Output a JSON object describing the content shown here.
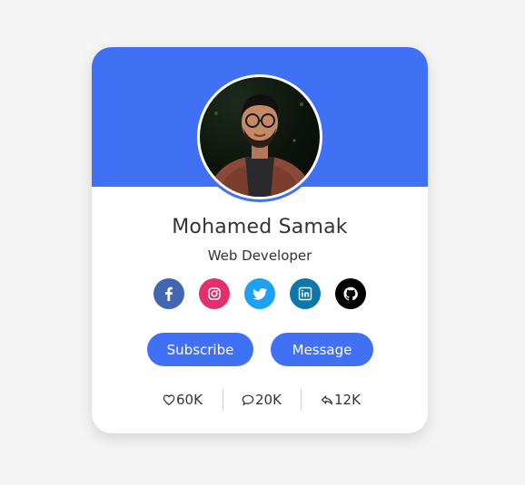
{
  "profile": {
    "name": "Mohamed Samak",
    "job": "Web Developer"
  },
  "socials": [
    {
      "name": "facebook",
      "icon": "facebook-icon",
      "color": "#4267b2"
    },
    {
      "name": "instagram",
      "icon": "instagram-icon",
      "color": "#e1306c"
    },
    {
      "name": "twitter",
      "icon": "twitter-icon",
      "color": "#1da1f2"
    },
    {
      "name": "linkedin",
      "icon": "linkedin-icon",
      "color": "#0e76a8"
    },
    {
      "name": "github",
      "icon": "github-icon",
      "color": "#000000"
    }
  ],
  "buttons": {
    "subscribe_label": "Subscribe",
    "message_label": "Message"
  },
  "stats": {
    "likes": "60K",
    "comments": "20K",
    "shares": "12K"
  },
  "colors": {
    "accent": "#4070f4",
    "text": "#333333",
    "background": "#f4f4f4"
  }
}
